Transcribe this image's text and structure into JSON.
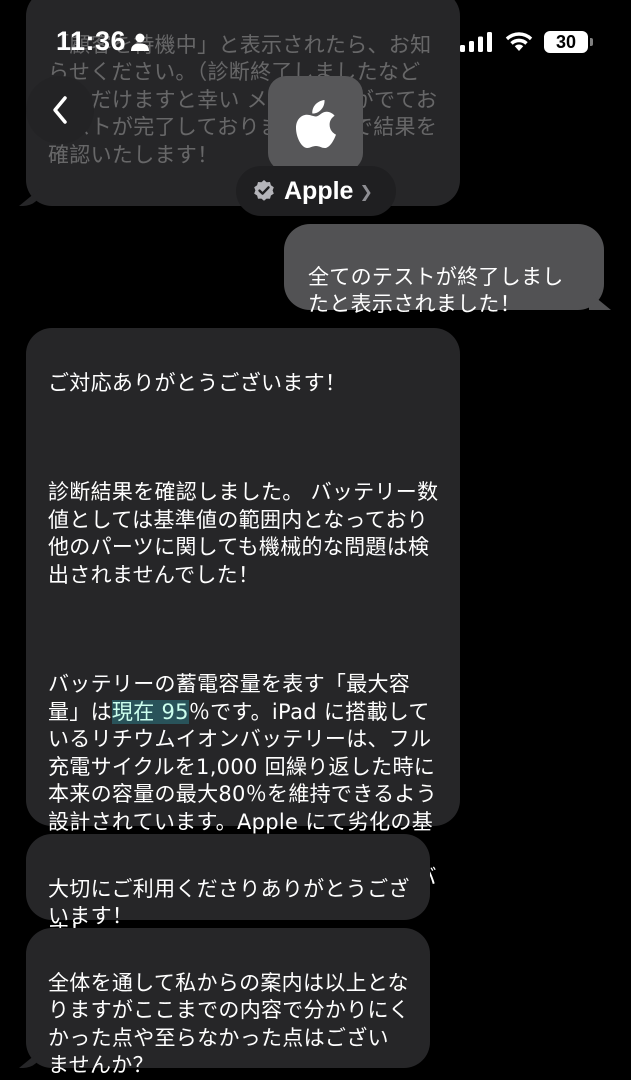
{
  "status_bar": {
    "time": "11:36",
    "battery_level": "30"
  },
  "header": {
    "contact_name": "Apple"
  },
  "messages": [
    {
      "direction": "incoming",
      "faded": true,
      "text": "「顧客を待機中」と表示されたら、お知らせください。（診断終了しましたなどいただけますと幸い メッセージがでてお テストが完了しておりますので で結果を確認いたします！"
    },
    {
      "direction": "outgoing",
      "text": "全てのテストが終了しましたと表示されました！"
    },
    {
      "direction": "incoming",
      "paragraphs": [
        "ご対応ありがとうございます！",
        "診断結果を確認しました。 バッテリー数値としては基準値の範囲内となっており他のパーツに関しても機械的な問題は検出されませんでした！",
        " バッテリーの蓄電容量を表す「最大容量」は",
        "現在 95",
        "％です。iPad に搭載しているリチウムイオンバッテリーは、フル充電サイクルを1,000 回繰り返した時に本来の容量の最大80％を維持できるよう設計されています。Apple にて劣化の基準とさせていただいている「最大容量 80％未満」には達していないことからバッテリーは正常値であると判断できます！"
      ]
    },
    {
      "direction": "incoming",
      "text": "大切にご利用くださりありがとうございます！"
    },
    {
      "direction": "incoming",
      "text": "全体を通して私からの案内は以上となりますがここまでの内容で分かりにくかった点や至らなかった点はございませんか？"
    }
  ],
  "colors": {
    "background": "#000000",
    "incoming_bubble": "#262628",
    "outgoing_bubble": "#525254",
    "highlight": "#2e8c96"
  },
  "icons": {
    "back": "chevron-left-icon",
    "avatar": "apple-logo-icon",
    "verified": "verified-badge-icon",
    "person": "person-icon",
    "signal": "cellular-signal-icon",
    "wifi": "wifi-icon"
  }
}
